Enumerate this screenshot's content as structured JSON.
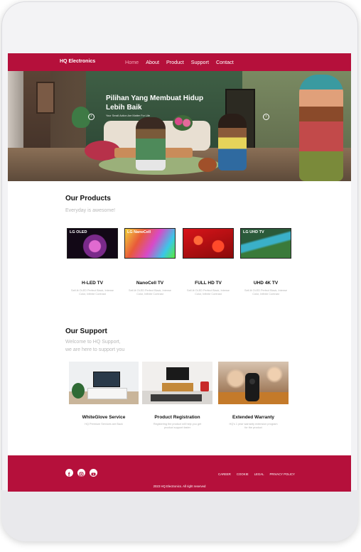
{
  "navbar": {
    "brand": "HQ Electronics",
    "links": [
      "Home",
      "About",
      "Product",
      "Support",
      "Contact"
    ],
    "active": "Home"
  },
  "hero": {
    "title": "Pilihan Yang Membuat Hidup Lebih Baik",
    "subtitle": "Your Small Action Are Matter For Life",
    "prev_icon": "chevron-left-icon",
    "next_icon": "chevron-right-icon"
  },
  "products": {
    "title": "Our Products",
    "subtitle": "Everyday is awesome!",
    "items": [
      {
        "name": "H-LED TV",
        "label": "LG OLED",
        "desc": "Self-lit OLED Perfect Black, Intense Color, Infinite Contrast"
      },
      {
        "name": "NanoCell TV",
        "label": "LG NanoCell",
        "desc": "Self-lit OLED Perfect Black, Intense Color, Infinite Contrast"
      },
      {
        "name": "FULL HD TV",
        "label": "",
        "desc": "Self-lit OLED Perfect Black, Intense Color, Infinite Contrast"
      },
      {
        "name": "UHD 4K TV",
        "label": "LG UHD TV",
        "desc": "Self-lit OLED Perfect Black, Intense Color, Infinite Contrast"
      }
    ]
  },
  "support": {
    "title": "Our Support",
    "subtitle_line1": "Welcome to HQ Support,",
    "subtitle_line2": "we are here to support you",
    "items": [
      {
        "name": "WhiteGlove Service",
        "desc": "HQ Premium Services are Back"
      },
      {
        "name": "Product Registration",
        "desc": "Registering the product will help you get product support faster"
      },
      {
        "name": "Extended Warranty",
        "desc": "HQ's 1 year warranty extension program for the product"
      }
    ]
  },
  "footer": {
    "social": [
      "facebook-icon",
      "instagram-icon",
      "youtube-icon"
    ],
    "links": [
      "CAREER",
      "COOKIE",
      "LEGAL",
      "PRIVACY POLICY"
    ],
    "copyright": "2023 HQ Electronics. All right reserved"
  },
  "colors": {
    "brand": "#b5103b",
    "active_link": "#f4a3b5",
    "muted_text": "#b8b8b8"
  }
}
